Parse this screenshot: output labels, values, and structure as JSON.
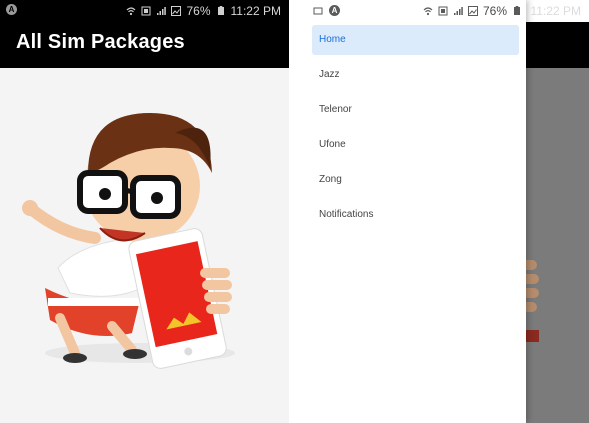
{
  "status_bar": {
    "battery": "76%",
    "time": "11:22 PM",
    "left_icon": "android-notification-icon"
  },
  "left_screen": {
    "app_title": "All Sim Packages",
    "hero_image": "cartoon-boy-with-phone"
  },
  "right_screen": {
    "drawer": {
      "items": [
        {
          "label": "Home",
          "active": true
        },
        {
          "label": "Jazz",
          "active": false
        },
        {
          "label": "Telenor",
          "active": false
        },
        {
          "label": "Ufone",
          "active": false
        },
        {
          "label": "Zong",
          "active": false
        },
        {
          "label": "Notifications",
          "active": false
        }
      ]
    }
  },
  "colors": {
    "appbar": "#000000",
    "active_item_bg": "#dcebfb",
    "active_item_text": "#1a6fd6",
    "scrim": "#7b7b7b"
  }
}
